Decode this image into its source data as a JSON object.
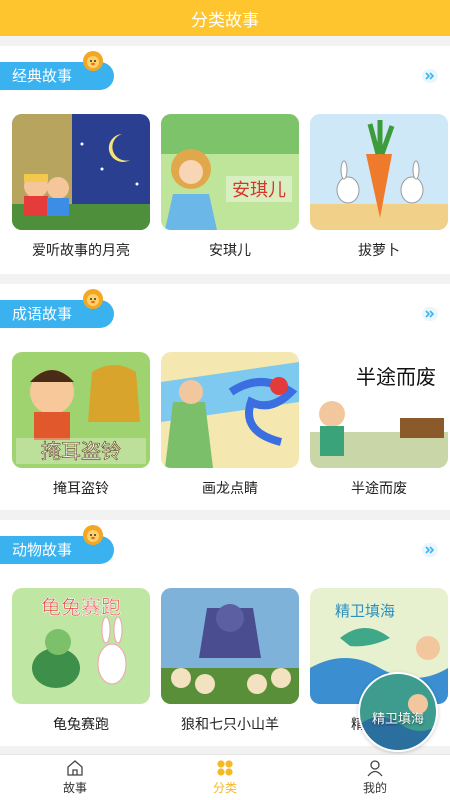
{
  "header": {
    "title": "分类故事"
  },
  "sections": [
    {
      "tag": "经典故事",
      "items": [
        "爱听故事的月亮",
        "安琪儿",
        "拔萝卜"
      ],
      "thumb_texts": [
        "",
        "安琪儿",
        ""
      ]
    },
    {
      "tag": "成语故事",
      "items": [
        "掩耳盗铃",
        "画龙点睛",
        "半途而废"
      ],
      "thumb_texts": [
        "掩耳盗铃",
        "",
        "半途而废"
      ]
    },
    {
      "tag": "动物故事",
      "items": [
        "龟兔赛跑",
        "狼和七只小山羊",
        "精卫填海"
      ],
      "thumb_texts": [
        "龟兔赛跑",
        "",
        "精卫填海"
      ]
    }
  ],
  "floating": {
    "label": "精卫填海"
  },
  "tabbar": {
    "items": [
      "故事",
      "分类",
      "我的"
    ],
    "active": "分类"
  },
  "colors": {
    "accent": "#ffc52e",
    "tag_blue": "#3bb2f0",
    "active_tab": "#f5b826"
  },
  "icons": {
    "section_more": "double-chevron-right-icon",
    "tab_story": "home-icon",
    "tab_category": "grid-icon",
    "tab_mine": "user-icon",
    "tag_decoration": "lion-icon"
  }
}
